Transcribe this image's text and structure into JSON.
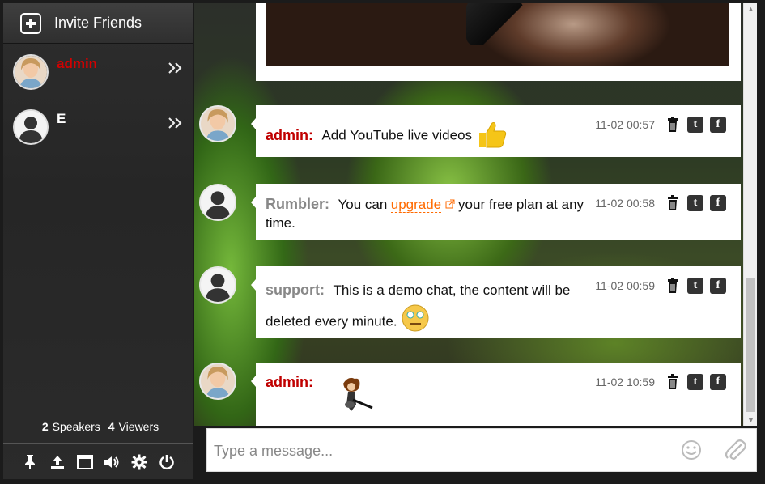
{
  "sidebar": {
    "invite_label": "Invite Friends",
    "users": [
      {
        "name": "admin",
        "name_color": "#d40000",
        "chevron": "»"
      },
      {
        "name": "E",
        "name_color": "#ffffff",
        "chevron": "»"
      }
    ],
    "counts": {
      "speakers": "2",
      "speakers_label": "Speakers",
      "viewers": "4",
      "viewers_label": "Viewers"
    },
    "toolbar_icons": [
      "pin-icon",
      "upload-icon",
      "window-icon",
      "volume-icon",
      "gear-icon",
      "power-icon"
    ]
  },
  "messages": [
    {
      "author": "admin:",
      "author_color": "#c00000",
      "text": "Add YouTube live videos",
      "time": "11-02 00:57",
      "emoji": "thumbs-up-icon"
    },
    {
      "author": "Rumbler:",
      "author_color": "#888888",
      "text_before": "You can",
      "link": "upgrade",
      "text_after": "your free plan at any time.",
      "time": "11-02 00:58"
    },
    {
      "author": "support:",
      "author_color": "#888888",
      "text": "This is a demo chat, the content will be deleted every minute.",
      "time": "11-02 00:59",
      "emoji": "dizzy-face-icon"
    },
    {
      "author": "admin:",
      "author_color": "#c00000",
      "text": "",
      "time": "11-02 10:59",
      "emoji": "guitar-sticker-icon"
    }
  ],
  "composer": {
    "placeholder": "Type a message..."
  },
  "colors": {
    "accent_link": "#ff6a00",
    "sidebar_bg": "#2b2b2b"
  }
}
